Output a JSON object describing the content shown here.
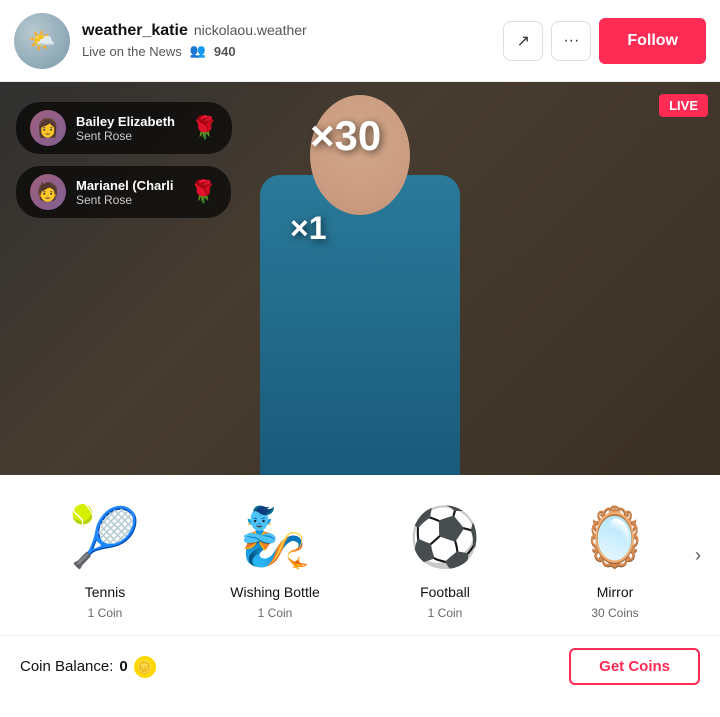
{
  "header": {
    "username": "weather_katie",
    "display_name": "nickolaou.weather",
    "live_label": "Live on the News",
    "viewers_icon": "👥",
    "viewer_count": "940",
    "share_icon": "↗",
    "more_icon": "•••",
    "follow_label": "Follow"
  },
  "video": {
    "live_badge": "LIVE",
    "multiplier_1": "×30",
    "multiplier_2": "×1",
    "notifications": [
      {
        "name": "Bailey Elizabeth",
        "action": "Sent Rose",
        "emoji": "🌹",
        "avatar_emoji": "🧑"
      },
      {
        "name": "Marianel (Charli",
        "action": "Sent Rose",
        "emoji": "🌹",
        "avatar_emoji": "🧑"
      }
    ]
  },
  "gifts": {
    "scroll_arrow": "›",
    "items": [
      {
        "name": "Tennis",
        "price": "1 Coin",
        "emoji": "🎾"
      },
      {
        "name": "Wishing Bottle",
        "price": "1 Coin",
        "emoji": "🧞"
      },
      {
        "name": "Football",
        "price": "1 Coin",
        "emoji": "⚽"
      },
      {
        "name": "Mirror",
        "price": "30 Coins",
        "emoji": "🪞"
      }
    ]
  },
  "footer": {
    "coin_balance_label": "Coin Balance:",
    "coin_amount": "0",
    "get_coins_label": "Get Coins"
  }
}
